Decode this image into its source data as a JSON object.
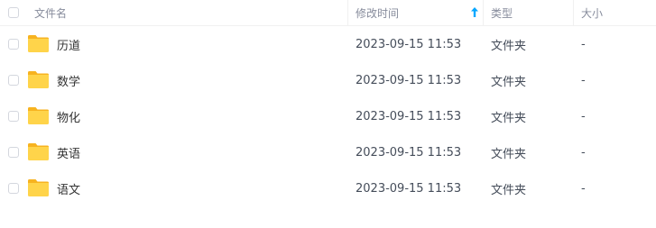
{
  "header": {
    "name_label": "文件名",
    "time_label": "修改时间",
    "type_label": "类型",
    "size_label": "大小",
    "sort_icon": "arrow-up-icon",
    "accent_color": "#06a7ff"
  },
  "rows": [
    {
      "name": "历道",
      "time": "2023-09-15 11:53",
      "type": "文件夹",
      "size": "-",
      "icon": "folder-icon"
    },
    {
      "name": "数学",
      "time": "2023-09-15 11:53",
      "type": "文件夹",
      "size": "-",
      "icon": "folder-icon"
    },
    {
      "name": "物化",
      "time": "2023-09-15 11:53",
      "type": "文件夹",
      "size": "-",
      "icon": "folder-icon"
    },
    {
      "name": "英语",
      "time": "2023-09-15 11:53",
      "type": "文件夹",
      "size": "-",
      "icon": "folder-icon"
    },
    {
      "name": "语文",
      "time": "2023-09-15 11:53",
      "type": "文件夹",
      "size": "-",
      "icon": "folder-icon"
    }
  ]
}
